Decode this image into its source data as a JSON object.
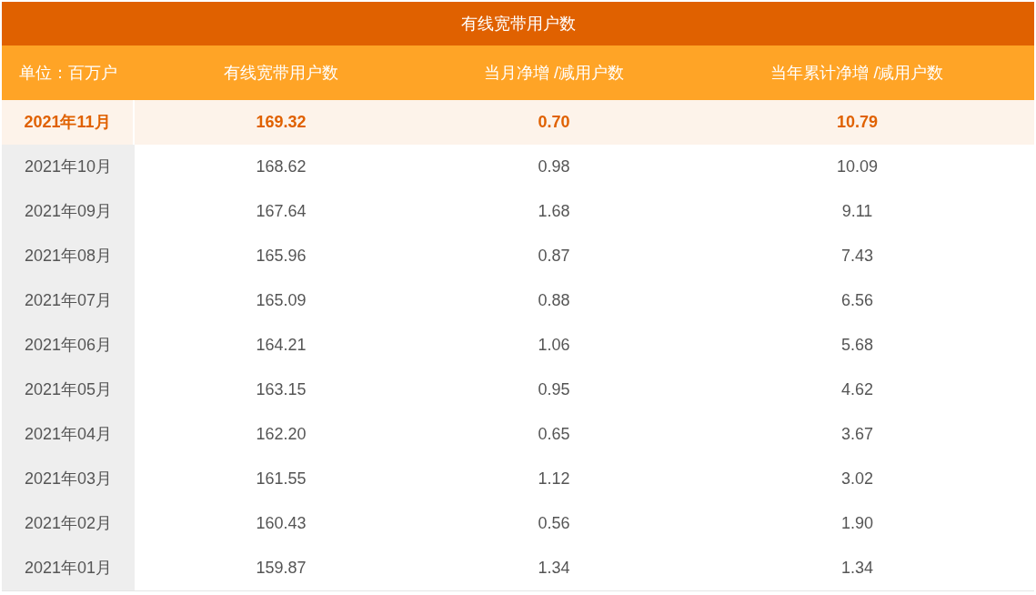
{
  "table": {
    "title": "有线宽带用户数",
    "columns": [
      "单位：百万户",
      "有线宽带用户数",
      "当月净增 /减用户数",
      "当年累计净增 /减用户数"
    ],
    "rows": [
      {
        "highlighted": true,
        "cells": [
          "2021年11月",
          "169.32",
          "0.70",
          "10.79"
        ]
      },
      {
        "highlighted": false,
        "cells": [
          "2021年10月",
          "168.62",
          "0.98",
          "10.09"
        ]
      },
      {
        "highlighted": false,
        "cells": [
          "2021年09月",
          "167.64",
          "1.68",
          "9.11"
        ]
      },
      {
        "highlighted": false,
        "cells": [
          "2021年08月",
          "165.96",
          "0.87",
          "7.43"
        ]
      },
      {
        "highlighted": false,
        "cells": [
          "2021年07月",
          "165.09",
          "0.88",
          "6.56"
        ]
      },
      {
        "highlighted": false,
        "cells": [
          "2021年06月",
          "164.21",
          "1.06",
          "5.68"
        ]
      },
      {
        "highlighted": false,
        "cells": [
          "2021年05月",
          "163.15",
          "0.95",
          "4.62"
        ]
      },
      {
        "highlighted": false,
        "cells": [
          "2021年04月",
          "162.20",
          "0.65",
          "3.67"
        ]
      },
      {
        "highlighted": false,
        "cells": [
          "2021年03月",
          "161.55",
          "1.12",
          "3.02"
        ]
      },
      {
        "highlighted": false,
        "cells": [
          "2021年02月",
          "160.43",
          "0.56",
          "1.90"
        ]
      },
      {
        "highlighted": false,
        "cells": [
          "2021年01月",
          "159.87",
          "1.34",
          "1.34"
        ]
      }
    ]
  }
}
